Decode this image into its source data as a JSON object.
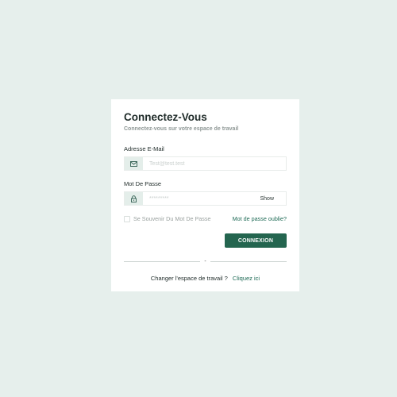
{
  "login": {
    "title": "Connectez-Vous",
    "subtitle": "Connectez-vous sur votre espace de travail",
    "email": {
      "label": "Adresse E-Mail",
      "placeholder": "Test@test.test",
      "value": "",
      "icon": "envelope-icon"
    },
    "password": {
      "label": "Mot De Passe",
      "placeholder": "*********",
      "value": "",
      "icon": "lock-icon",
      "show_label": "Show"
    },
    "remember_label": "Se Souvenir Du Mot De Passe",
    "forgot_label": "Mot de passe oublie?",
    "submit_label": "CONNEXION",
    "divider_text": "-",
    "workspace_question": "Changer l'espace de travail ?",
    "workspace_link": "Cliquez ici"
  },
  "colors": {
    "page_background": "#e6efec",
    "card_background": "#ffffff",
    "accent": "#24654f",
    "link": "#1f6b56",
    "icon_box": "#e4eeea"
  }
}
